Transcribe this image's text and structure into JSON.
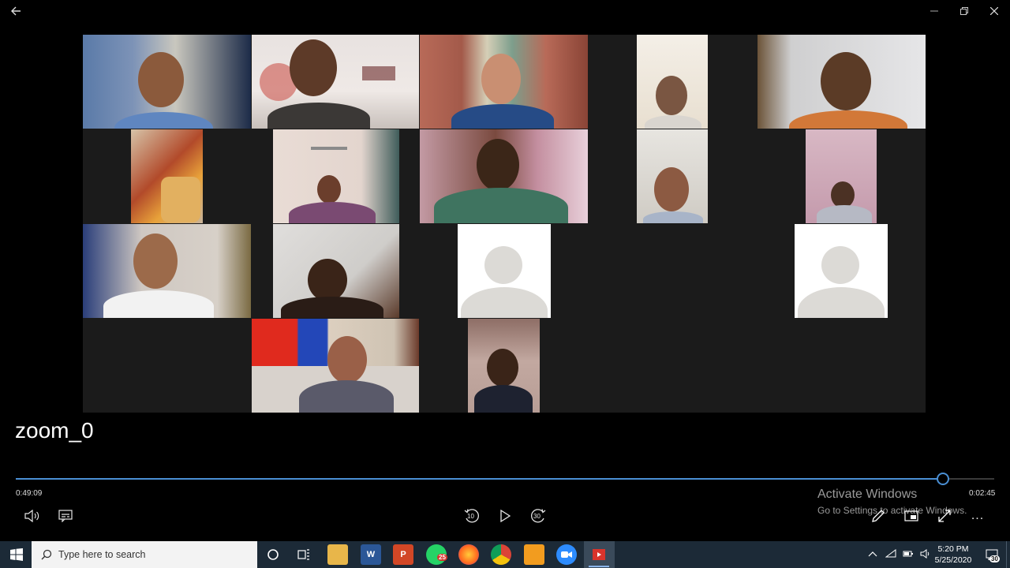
{
  "window": {
    "back_icon": "back-arrow-icon",
    "controls": [
      "minimize",
      "restore",
      "close"
    ]
  },
  "video": {
    "title": "zoom_0",
    "elapsed": "0:49:09",
    "remaining": "0:02:45",
    "progress": 0.947
  },
  "player_controls": {
    "volume": "volume-icon",
    "captions": "captions-icon",
    "skip_back_label": "10",
    "play": "play-icon",
    "skip_forward_label": "30",
    "edit": "pencil-icon",
    "mini_view": "mini-view-icon",
    "fullscreen": "expand-icon",
    "more": "..."
  },
  "watermark": {
    "line1": "Activate Windows",
    "line2": "Go to Settings to activate Windows."
  },
  "taskbar": {
    "search_placeholder": "Type here to search",
    "whatsapp_badge": "25",
    "apps": [
      "cortana",
      "task-view",
      "file-explorer",
      "word",
      "powerpoint",
      "whatsapp",
      "firefox",
      "chrome",
      "vlc-like",
      "zoom",
      "video-player"
    ],
    "time": "5:20 PM",
    "date": "5/25/2020",
    "notification_count": "30"
  }
}
